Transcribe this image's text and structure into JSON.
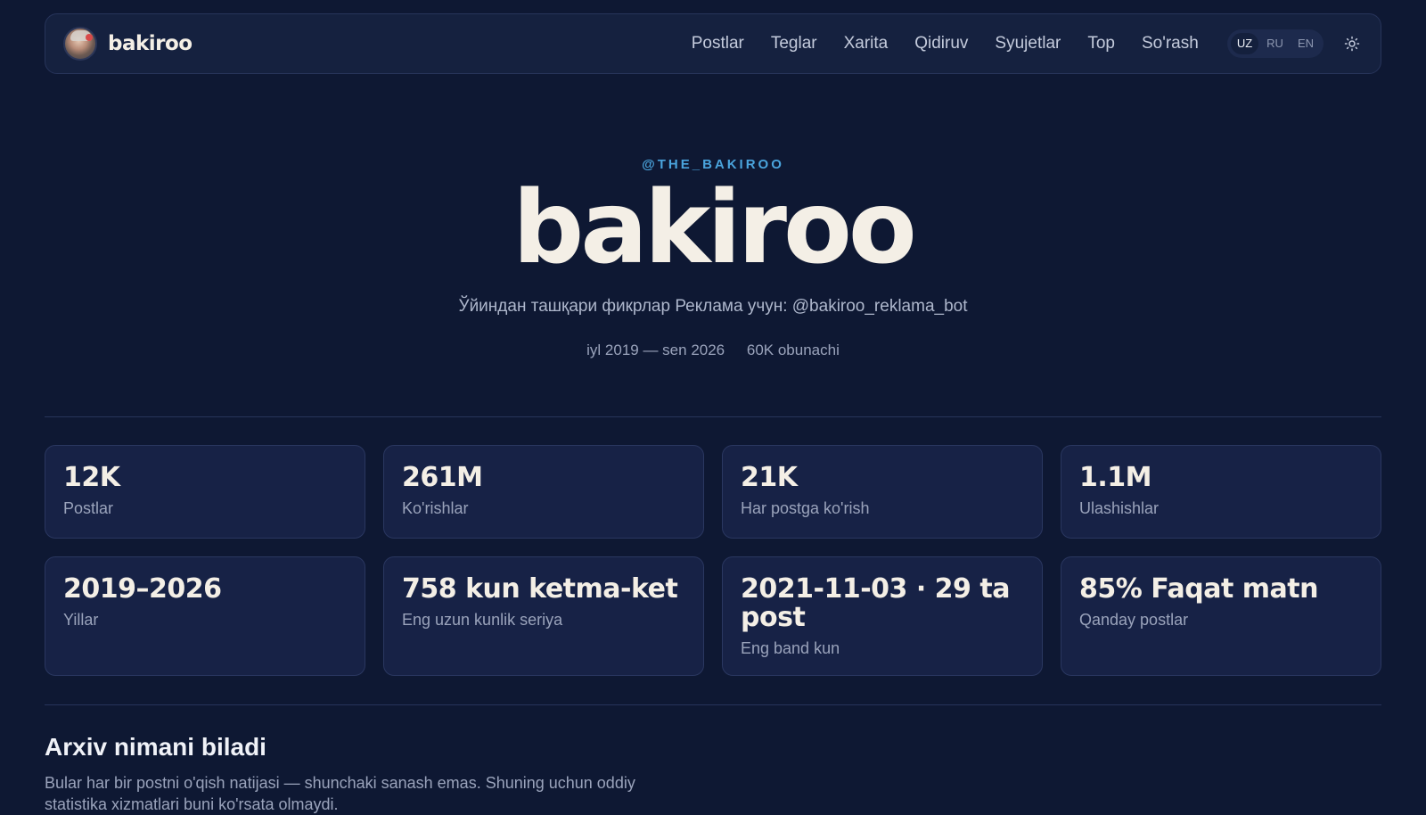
{
  "brand": {
    "name": "bakiroo",
    "avatar_icon": "user-avatar"
  },
  "nav": {
    "links": [
      "Postlar",
      "Teglar",
      "Xarita",
      "Qidiruv",
      "Syujetlar",
      "Top",
      "So'rash"
    ],
    "languages": [
      "UZ",
      "RU",
      "EN"
    ],
    "active_language": "UZ",
    "theme_icon": "sun-icon"
  },
  "hero": {
    "handle": "@THE_BAKIROO",
    "title": "bakiroo",
    "description": "Ўйиндан ташқари фикрлар Реклама учун: @bakiroo_reklama_bot",
    "period": "iyl 2019 — sen 2026",
    "subscribers": "60K obunachi"
  },
  "stats": [
    {
      "value": "12K",
      "label": "Postlar"
    },
    {
      "value": "261M",
      "label": "Ko'rishlar"
    },
    {
      "value": "21K",
      "label": "Har postga ko'rish"
    },
    {
      "value": "1.1M",
      "label": "Ulashishlar"
    },
    {
      "value": "2019–2026",
      "label": "Yillar"
    },
    {
      "value": "758 kun ketma-ket",
      "label": "Eng uzun kunlik seriya"
    },
    {
      "value": "2021-11-03 · 29 ta post",
      "label": "Eng band kun"
    },
    {
      "value": "85% Faqat matn",
      "label": "Qanday postlar"
    }
  ],
  "section": {
    "title": "Arxiv nimani biladi",
    "text": "Bular har bir postni o'qish natijasi — shunchaki sanash emas. Shuning uchun oddiy statistika xizmatlari buni ko'rsata olmaydi."
  },
  "colors": {
    "background": "#0e1833",
    "card": "#172246",
    "accent": "#4aa4dd",
    "title": "#f4efe6"
  }
}
